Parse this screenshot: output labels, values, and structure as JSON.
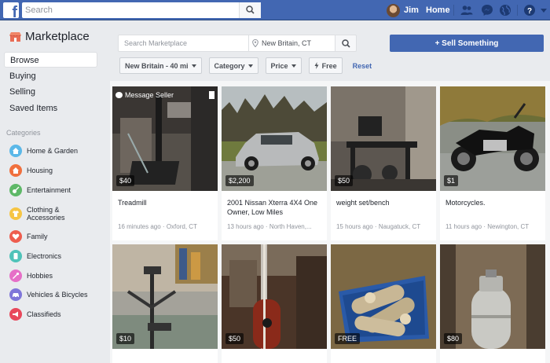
{
  "topbar": {
    "search_placeholder": "Search",
    "user_name": "Jim",
    "home_label": "Home"
  },
  "sidebar": {
    "title": "Marketplace",
    "nav": [
      {
        "label": "Browse",
        "active": true
      },
      {
        "label": "Buying"
      },
      {
        "label": "Selling"
      },
      {
        "label": "Saved Items"
      }
    ],
    "categories_title": "Categories",
    "categories": [
      {
        "label": "Home & Garden",
        "color": "#5bb8e8"
      },
      {
        "label": "Housing",
        "color": "#f0703e"
      },
      {
        "label": "Entertainment",
        "color": "#5eb868"
      },
      {
        "label": "Clothing & Accessories",
        "color": "#f6c544"
      },
      {
        "label": "Family",
        "color": "#ee5d4e"
      },
      {
        "label": "Electronics",
        "color": "#4fc3b9"
      },
      {
        "label": "Hobbies",
        "color": "#e66fc7"
      },
      {
        "label": "Vehicles & Bicycles",
        "color": "#7f76d9"
      },
      {
        "label": "Classifieds",
        "color": "#e8485b"
      }
    ]
  },
  "marketplace_search": {
    "placeholder": "Search Marketplace",
    "location": "New Britain, CT"
  },
  "sell_button": "+ Sell Something",
  "filters": {
    "distance": "New Britain - 40 mi",
    "category": "Category",
    "price": "Price",
    "free": "Free",
    "reset": "Reset"
  },
  "overlay_label": "Message Seller",
  "listings": [
    {
      "price": "$40",
      "title": "Treadmill",
      "meta": "16 minutes ago · Oxford, CT"
    },
    {
      "price": "$2,200",
      "title": "2001 Nissan Xterra 4X4 One Owner, Low Miles",
      "meta": "13 hours ago · North Haven,..."
    },
    {
      "price": "$50",
      "title": "weight set/bench",
      "meta": "15 hours ago · Naugatuck, CT"
    },
    {
      "price": "$1",
      "title": "Motorcycles.",
      "meta": "11 hours ago · Newington, CT"
    },
    {
      "price": "$10",
      "title": "",
      "meta": ""
    },
    {
      "price": "$50",
      "title": "",
      "meta": ""
    },
    {
      "price": "FREE",
      "title": "",
      "meta": ""
    },
    {
      "price": "$80",
      "title": "",
      "meta": ""
    }
  ],
  "icons": {
    "logo": "facebook-logo-icon",
    "search": "search-icon",
    "friends": "friends-icon",
    "messenger": "messenger-icon",
    "notifications": "globe-icon",
    "help": "help-icon",
    "menu": "caret-down-icon"
  }
}
